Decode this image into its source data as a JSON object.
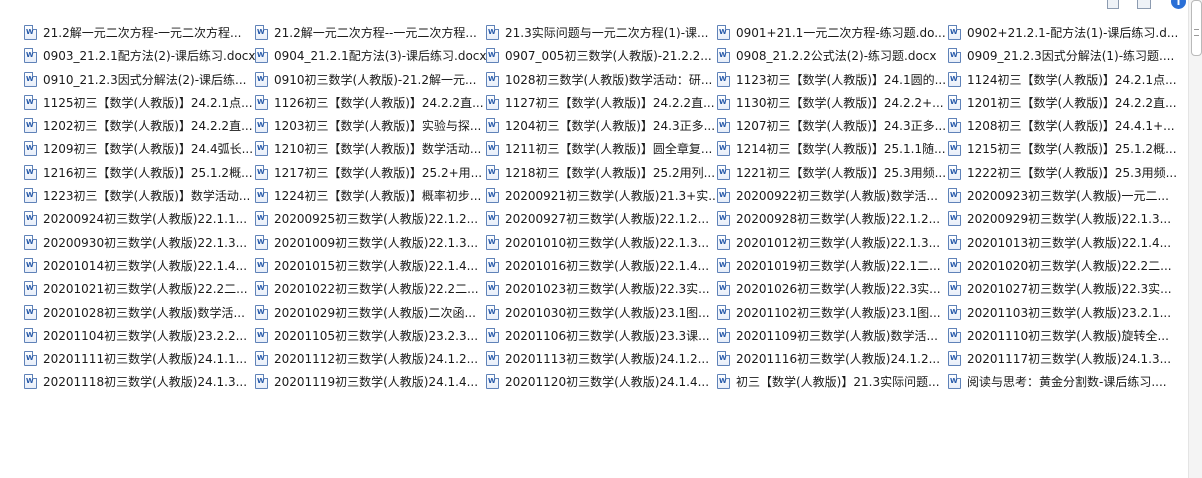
{
  "toolbar": {
    "help_glyph": "i",
    "icons": [
      "view-options-icon",
      "preview-pane-icon",
      "help-icon"
    ]
  },
  "files": [
    "21.2解一元二次方程-一元二次方程...",
    "21.2解一元二次方程--一元二次方程...",
    "21.3实际问题与一元二次方程(1)-课...",
    "0901+21.1一元二次方程-练习题.do...",
    "0902+21.2.1-配方法(1)-课后练习.d...",
    "0903_21.2.1配方法(2)-课后练习.docx",
    "0904_21.2.1配方法(3)-课后练习.docx",
    "0907_005初三数学(人教版)-21.2.2...",
    "0908_21.2.2公式法(2)-练习题.docx",
    "0909_21.2.3因式分解法(1)-练习题....",
    "0910_21.2.3因式分解法(2)-课后练...",
    "0910初三数学(人教版)-21.2解一元...",
    "1028初三数学(人教版)数学活动：研...",
    "1123初三【数学(人教版)】24.1圆的...",
    "1124初三【数学(人教版)】24.2.1点...",
    "1125初三【数学(人教版)】24.2.1点...",
    "1126初三【数学(人教版)】24.2.2直...",
    "1127初三【数学(人教版)】24.2.2直...",
    "1130初三【数学(人教版)】24.2.2+...",
    "1201初三【数学(人教版)】24.2.2直...",
    "1202初三【数学(人教版)】24.2.2直...",
    "1203初三【数学(人教版)】实验与探...",
    "1204初三【数学(人教版)】24.3正多...",
    "1207初三【数学(人教版)】24.3正多...",
    "1208初三【数学(人教版)】24.4.1+...",
    "1209初三【数学(人教版)】24.4弧长...",
    "1210初三【数学(人教版)】数学活动...",
    "1211初三【数学(人教版)】圆全章复...",
    "1214初三【数学(人教版)】25.1.1随...",
    "1215初三【数学(人教版)】25.1.2概...",
    "1216初三【数学(人教版)】25.1.2概...",
    "1217初三【数学(人教版)】25.2+用...",
    "1218初三【数学(人教版)】25.2用列...",
    "1221初三【数学(人教版)】25.3用频...",
    "1222初三【数学(人教版)】25.3用频...",
    "1223初三【数学(人教版)】数学活动...",
    "1224初三【数学(人教版)】概率初步...",
    "20200921初三数学(人教版)21.3+实...",
    "20200922初三数学(人教版)数学活...",
    "20200923初三数学(人教版)一元二...",
    "20200924初三数学(人教版)22.1.1...",
    "20200925初三数学(人教版)22.1.2...",
    "20200927初三数学(人教版)22.1.2...",
    "20200928初三数学(人教版)22.1.2...",
    "20200929初三数学(人教版)22.1.3...",
    "20200930初三数学(人教版)22.1.3...",
    "20201009初三数学(人教版)22.1.3...",
    "20201010初三数学(人教版)22.1.3...",
    "20201012初三数学(人教版)22.1.3...",
    "20201013初三数学(人教版)22.1.4...",
    "20201014初三数学(人教版)22.1.4...",
    "20201015初三数学(人教版)22.1.4...",
    "20201016初三数学(人教版)22.1.4...",
    "20201019初三数学(人教版)22.1二...",
    "20201020初三数学(人教版)22.2二...",
    "20201021初三数学(人教版)22.2二...",
    "20201022初三数学(人教版)22.2二...",
    "20201023初三数学(人教版)22.3实...",
    "20201026初三数学(人教版)22.3实...",
    "20201027初三数学(人教版)22.3实...",
    "20201028初三数学(人教版)数学活...",
    "20201029初三数学(人教版)二次函...",
    "20201030初三数学(人教版)23.1图...",
    "20201102初三数学(人教版)23.1图...",
    "20201103初三数学(人教版)23.2.1...",
    "20201104初三数学(人教版)23.2.2...",
    "20201105初三数学(人教版)23.2.3...",
    "20201106初三数学(人教版)23.3课...",
    "20201109初三数学(人教版)数学活...",
    "20201110初三数学(人教版)旋转全...",
    "20201111初三数学(人教版)24.1.1...",
    "20201112初三数学(人教版)24.1.2...",
    "20201113初三数学(人教版)24.1.2...",
    "20201116初三数学(人教版)24.1.2...",
    "20201117初三数学(人教版)24.1.3...",
    "20201118初三数学(人教版)24.1.3...",
    "20201119初三数学(人教版)24.1.4...",
    "20201120初三数学(人教版)24.1.4...",
    "初三【数学(人教版)】21.3实际问题...",
    "阅读与思考：黄金分割数-课后练习...."
  ]
}
